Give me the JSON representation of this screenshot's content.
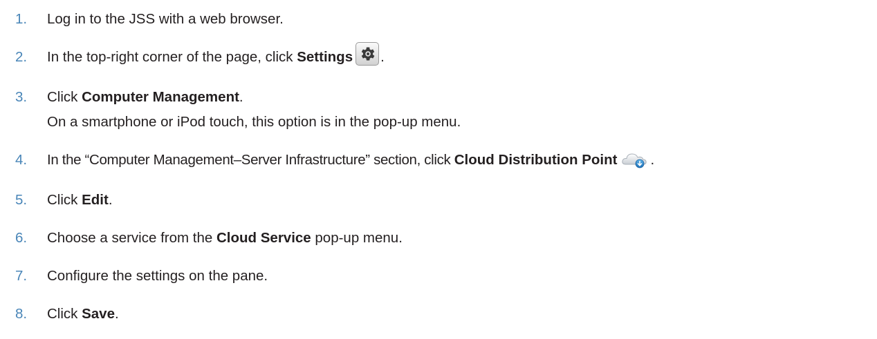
{
  "steps": [
    {
      "number": "1.",
      "parts": {
        "a": "Log in to the JSS with a web browser."
      }
    },
    {
      "number": "2.",
      "parts": {
        "a": "In the top-right corner of the page, click ",
        "b": "Settings",
        "c": "."
      },
      "icon": "gear-icon"
    },
    {
      "number": "3.",
      "parts": {
        "a": "Click ",
        "b": "Computer Management",
        "c": "."
      },
      "note": "On a smartphone or iPod touch, this option is in the pop-up menu."
    },
    {
      "number": "4.",
      "parts": {
        "a": "In the “Computer Management–Server Infrastructure” section, click ",
        "b": "Cloud Distribution Point",
        "c": "."
      },
      "icon": "cloud-distribution-point-icon"
    },
    {
      "number": "5.",
      "parts": {
        "a": "Click ",
        "b": "Edit",
        "c": "."
      }
    },
    {
      "number": "6.",
      "parts": {
        "a": "Choose a service from the ",
        "b": "Cloud Service",
        "c": " pop-up menu."
      }
    },
    {
      "number": "7.",
      "parts": {
        "a": "Configure the settings on the pane."
      }
    },
    {
      "number": "8.",
      "parts": {
        "a": "Click ",
        "b": "Save",
        "c": "."
      }
    }
  ],
  "colors": {
    "step_number": "#4a86b8",
    "text": "#231f20"
  }
}
